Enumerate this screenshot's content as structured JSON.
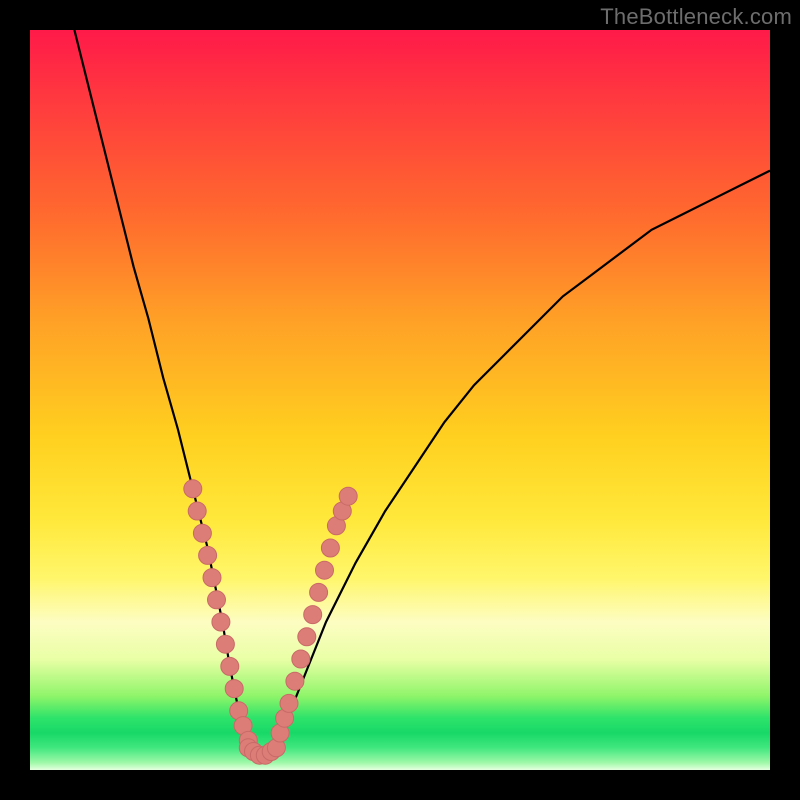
{
  "watermark": "TheBottleneck.com",
  "colors": {
    "curve": "#000000",
    "marker_fill": "#dc7d78",
    "marker_stroke": "#c96a67",
    "background_border": "#000000"
  },
  "chart_data": {
    "type": "line",
    "title": "",
    "xlabel": "",
    "ylabel": "",
    "xlim": [
      0,
      100
    ],
    "ylim": [
      0,
      100
    ],
    "grid": false,
    "legend": false,
    "series": [
      {
        "name": "bottleneck-curve",
        "x": [
          6,
          8,
          10,
          12,
          14,
          16,
          18,
          20,
          22,
          23,
          24,
          25,
          26,
          27,
          28,
          29,
          30,
          31,
          32,
          33,
          34,
          36,
          38,
          40,
          44,
          48,
          52,
          56,
          60,
          64,
          68,
          72,
          76,
          80,
          84,
          88,
          92,
          96,
          100
        ],
        "y": [
          100,
          92,
          84,
          76,
          68,
          61,
          53,
          46,
          38,
          34,
          30,
          25,
          20,
          14,
          9,
          5,
          3,
          2,
          2,
          3,
          5,
          10,
          15,
          20,
          28,
          35,
          41,
          47,
          52,
          56,
          60,
          64,
          67,
          70,
          73,
          75,
          77,
          79,
          81
        ]
      }
    ],
    "markers": {
      "left_branch": [
        {
          "x": 22,
          "y": 38
        },
        {
          "x": 22.6,
          "y": 35
        },
        {
          "x": 23.3,
          "y": 32
        },
        {
          "x": 24,
          "y": 29
        },
        {
          "x": 24.6,
          "y": 26
        },
        {
          "x": 25.2,
          "y": 23
        },
        {
          "x": 25.8,
          "y": 20
        },
        {
          "x": 26.4,
          "y": 17
        },
        {
          "x": 27,
          "y": 14
        },
        {
          "x": 27.6,
          "y": 11
        },
        {
          "x": 28.2,
          "y": 8
        },
        {
          "x": 28.8,
          "y": 6
        },
        {
          "x": 29.5,
          "y": 4
        }
      ],
      "bottom": [
        {
          "x": 29.5,
          "y": 3
        },
        {
          "x": 30.2,
          "y": 2.5
        },
        {
          "x": 31,
          "y": 2
        },
        {
          "x": 31.8,
          "y": 2
        },
        {
          "x": 32.6,
          "y": 2.5
        },
        {
          "x": 33.3,
          "y": 3
        }
      ],
      "right_branch": [
        {
          "x": 33.8,
          "y": 5
        },
        {
          "x": 34.4,
          "y": 7
        },
        {
          "x": 35,
          "y": 9
        },
        {
          "x": 35.8,
          "y": 12
        },
        {
          "x": 36.6,
          "y": 15
        },
        {
          "x": 37.4,
          "y": 18
        },
        {
          "x": 38.2,
          "y": 21
        },
        {
          "x": 39,
          "y": 24
        },
        {
          "x": 39.8,
          "y": 27
        },
        {
          "x": 40.6,
          "y": 30
        },
        {
          "x": 41.4,
          "y": 33
        },
        {
          "x": 42.2,
          "y": 35
        },
        {
          "x": 43,
          "y": 37
        }
      ]
    }
  }
}
